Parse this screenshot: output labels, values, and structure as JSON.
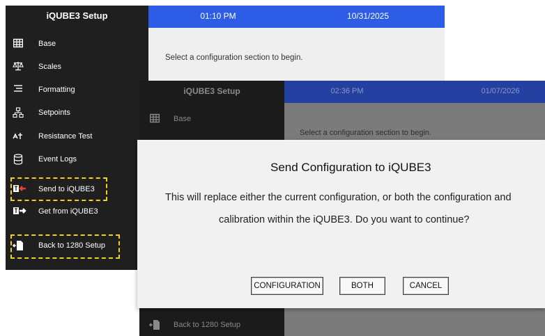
{
  "back_window": {
    "app_title": "iQUBE3 Setup",
    "time": "01:10 PM",
    "date": "10/31/2025",
    "main_message": "Select a configuration section to begin.",
    "menu": [
      {
        "label": "Base",
        "icon": "grid-icon"
      },
      {
        "label": "Scales",
        "icon": "scale-icon"
      },
      {
        "label": "Formatting",
        "icon": "list-format-icon"
      },
      {
        "label": "Setpoints",
        "icon": "hierarchy-icon"
      },
      {
        "label": "Resistance Test",
        "icon": "resistance-icon"
      },
      {
        "label": "Event Logs",
        "icon": "database-icon"
      },
      {
        "label": "Send to iQUBE3",
        "icon": "send-icon",
        "highlighted": true
      },
      {
        "label": "Get from iQUBE3",
        "icon": "receive-icon"
      },
      {
        "label": "Back to 1280 Setup",
        "icon": "back-document-icon",
        "highlighted": true
      }
    ]
  },
  "front_window": {
    "app_title": "iQUBE3 Setup",
    "time": "02:36 PM",
    "date": "01/07/2026",
    "main_message": "Select a configuration section to begin.",
    "visible_menu": [
      {
        "label": "Base",
        "icon": "grid-icon"
      },
      {
        "label": "Back to 1280 Setup",
        "icon": "back-document-icon"
      }
    ]
  },
  "dialog": {
    "title": "Send Configuration to iQUBE3",
    "line1": "This will replace either the current configuration, or both the configuration and",
    "line2": "calibration within the iQUBE3. Do you want to continue?",
    "buttons": {
      "configuration": "CONFIGURATION",
      "both": "BOTH",
      "cancel": "CANCEL"
    }
  },
  "colors": {
    "sidebar": "#1f1f1f",
    "topbar": "#2d5ce6",
    "highlight": "#f2d21b",
    "send_icon_arrow": "#e8412c"
  }
}
